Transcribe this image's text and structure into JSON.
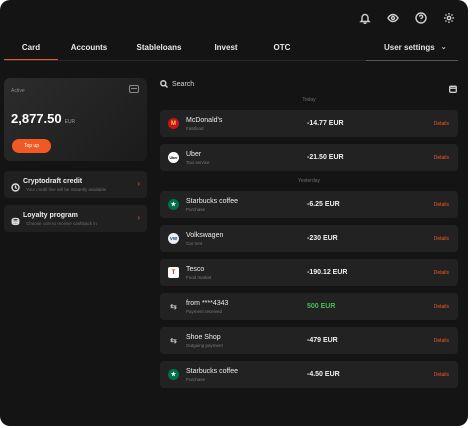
{
  "header_icons": [
    "bell-icon",
    "eye-icon",
    "help-icon",
    "gear-icon"
  ],
  "tabs": [
    {
      "label": "Card",
      "active": true
    },
    {
      "label": "Accounts",
      "active": false
    },
    {
      "label": "Stableloans",
      "active": false
    },
    {
      "label": "Invest",
      "active": false
    },
    {
      "label": "OTC",
      "active": false
    }
  ],
  "user_settings_label": "User settings",
  "card": {
    "status": "Active",
    "balance": "2,877.50",
    "currency": "EUR",
    "topup_label": "Top up"
  },
  "promos": [
    {
      "title": "Cryptodraft credit",
      "subtitle": "Your credit line will be instantly available",
      "icon": "refresh-icon"
    },
    {
      "title": "Loyalty program",
      "subtitle": "Choose coin to receive cashback in",
      "icon": "coins-icon"
    }
  ],
  "search": {
    "placeholder": "Search"
  },
  "date_labels": {
    "today": "Today",
    "yesterday": "Yesterday"
  },
  "details_label": "Details",
  "transactions": [
    {
      "name": "McDonald's",
      "category": "Fastfood",
      "amount": "-14.77 EUR",
      "logo": "M",
      "logo_bg": "#c8101e",
      "logo_fg": "#ffc72c"
    },
    {
      "name": "Uber",
      "category": "Taxi service",
      "amount": "-21.50 EUR",
      "logo": "Uber",
      "logo_bg": "#ffffff",
      "logo_fg": "#000000"
    },
    {
      "name": "Starbucks coffee",
      "category": "Purchase",
      "amount": "-6.25 EUR",
      "logo": "★",
      "logo_bg": "#00704a",
      "logo_fg": "#ffffff"
    },
    {
      "name": "Volkswagen",
      "category": "Car rent",
      "amount": "-230 EUR",
      "logo": "VW",
      "logo_bg": "#e9eef4",
      "logo_fg": "#1b3a6b"
    },
    {
      "name": "Tesco",
      "category": "Food market",
      "amount": "-190.12 EUR",
      "logo": "T",
      "logo_bg": "#ffffff",
      "logo_fg": "#e11d2b"
    },
    {
      "name": "from ****4343",
      "category": "Payment received",
      "amount": "500 EUR",
      "logo": "⇆",
      "logo_bg": "transparent",
      "logo_fg": "#bdbdbd",
      "positive": true
    },
    {
      "name": "Shoe Shop",
      "category": "Outgoing payment",
      "amount": "-479 EUR",
      "logo": "⇆",
      "logo_bg": "transparent",
      "logo_fg": "#bdbdbd"
    },
    {
      "name": "Starbucks coffee",
      "category": "Purchase",
      "amount": "-4.50 EUR",
      "logo": "★",
      "logo_bg": "#00704a",
      "logo_fg": "#ffffff"
    }
  ],
  "colors": {
    "accent": "#f05a22",
    "positive": "#4cbb5a",
    "background": "#141414",
    "panel": "#222222"
  }
}
